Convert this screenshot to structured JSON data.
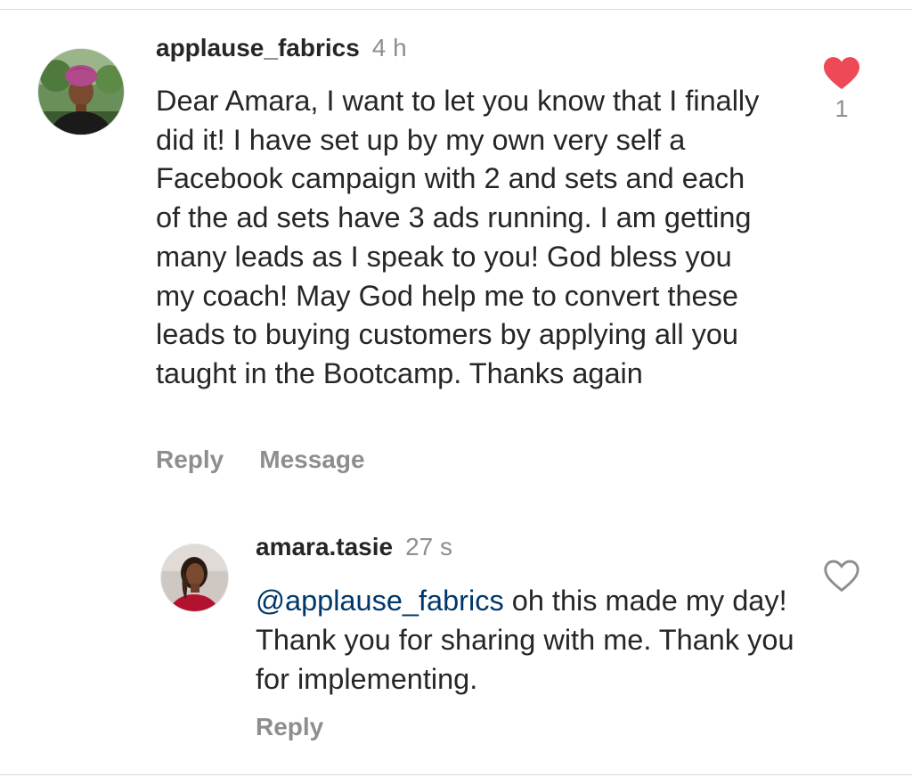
{
  "colors": {
    "text": "#262626",
    "secondary": "#8e8e8e",
    "mention": "#00376b",
    "like_red": "#ed4956",
    "divider": "#dbdbdb"
  },
  "comments": [
    {
      "username": "applause_fabrics",
      "time": "4 h",
      "text": "Dear Amara, I want to let you know that I finally did it! I have set up by my own very self a Facebook campaign with 2 and sets and each of the ad sets have 3 ads running. I am getting many leads as I speak to you! God bless you my coach! May God help me to convert these leads to buying customers by applying all you taught in the Bootcamp. Thanks again",
      "reply_label": "Reply",
      "message_label": "Message",
      "like_icon": "heart-filled-icon",
      "likes": "1",
      "liked": true
    },
    {
      "username": "amara.tasie",
      "time": "27 s",
      "mention": "@applause_fabrics",
      "text": " oh this made my day! Thank you for sharing with me. Thank you for implementing.",
      "reply_label": "Reply",
      "like_icon": "heart-outline-icon",
      "liked": false
    }
  ]
}
